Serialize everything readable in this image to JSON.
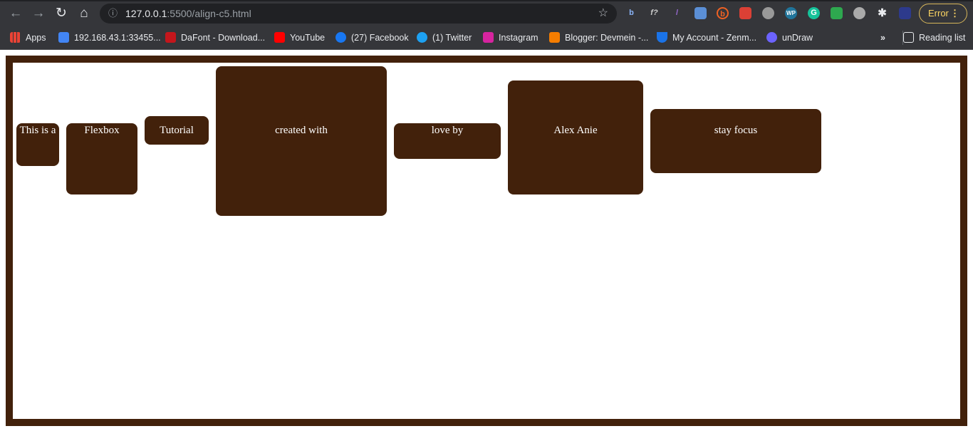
{
  "browser": {
    "url_host": "127.0.0.1",
    "url_path": ":5500/align-c5.html",
    "error_label": "Error",
    "extensions": [
      "b-icon",
      "f-icon",
      "feather-icon",
      "window-icon",
      "bitly-icon",
      "todoist-icon",
      "circle-icon",
      "wp-icon",
      "grammarly-icon",
      "sync-icon",
      "s-icon",
      "puzzle-icon",
      "profile-icon"
    ],
    "bookmarks": [
      {
        "label": "Apps",
        "color": "#fbbc04"
      },
      {
        "label": "192.168.43.1:33455...",
        "color": "#4285f4"
      },
      {
        "label": "DaFont - Download...",
        "color": "#c4161c"
      },
      {
        "label": "YouTube",
        "color": "#ff0000"
      },
      {
        "label": "(27) Facebook",
        "color": "#1877f2"
      },
      {
        "label": "(1) Twitter",
        "color": "#1da1f2"
      },
      {
        "label": "Instagram",
        "color": "#d6249f"
      },
      {
        "label": "Blogger: Devmein -...",
        "color": "#f57d00"
      },
      {
        "label": "My Account - Zenm...",
        "color": "#1a73e8"
      },
      {
        "label": "unDraw",
        "color": "#6c63ff"
      }
    ],
    "overflow_label": "»",
    "reading_list_label": "Reading list"
  },
  "page": {
    "accent": "#42210b",
    "items": [
      "This is a",
      "Flexbox",
      "Tutorial",
      "created with",
      "love by",
      "Alex Anie",
      "stay focus"
    ]
  }
}
